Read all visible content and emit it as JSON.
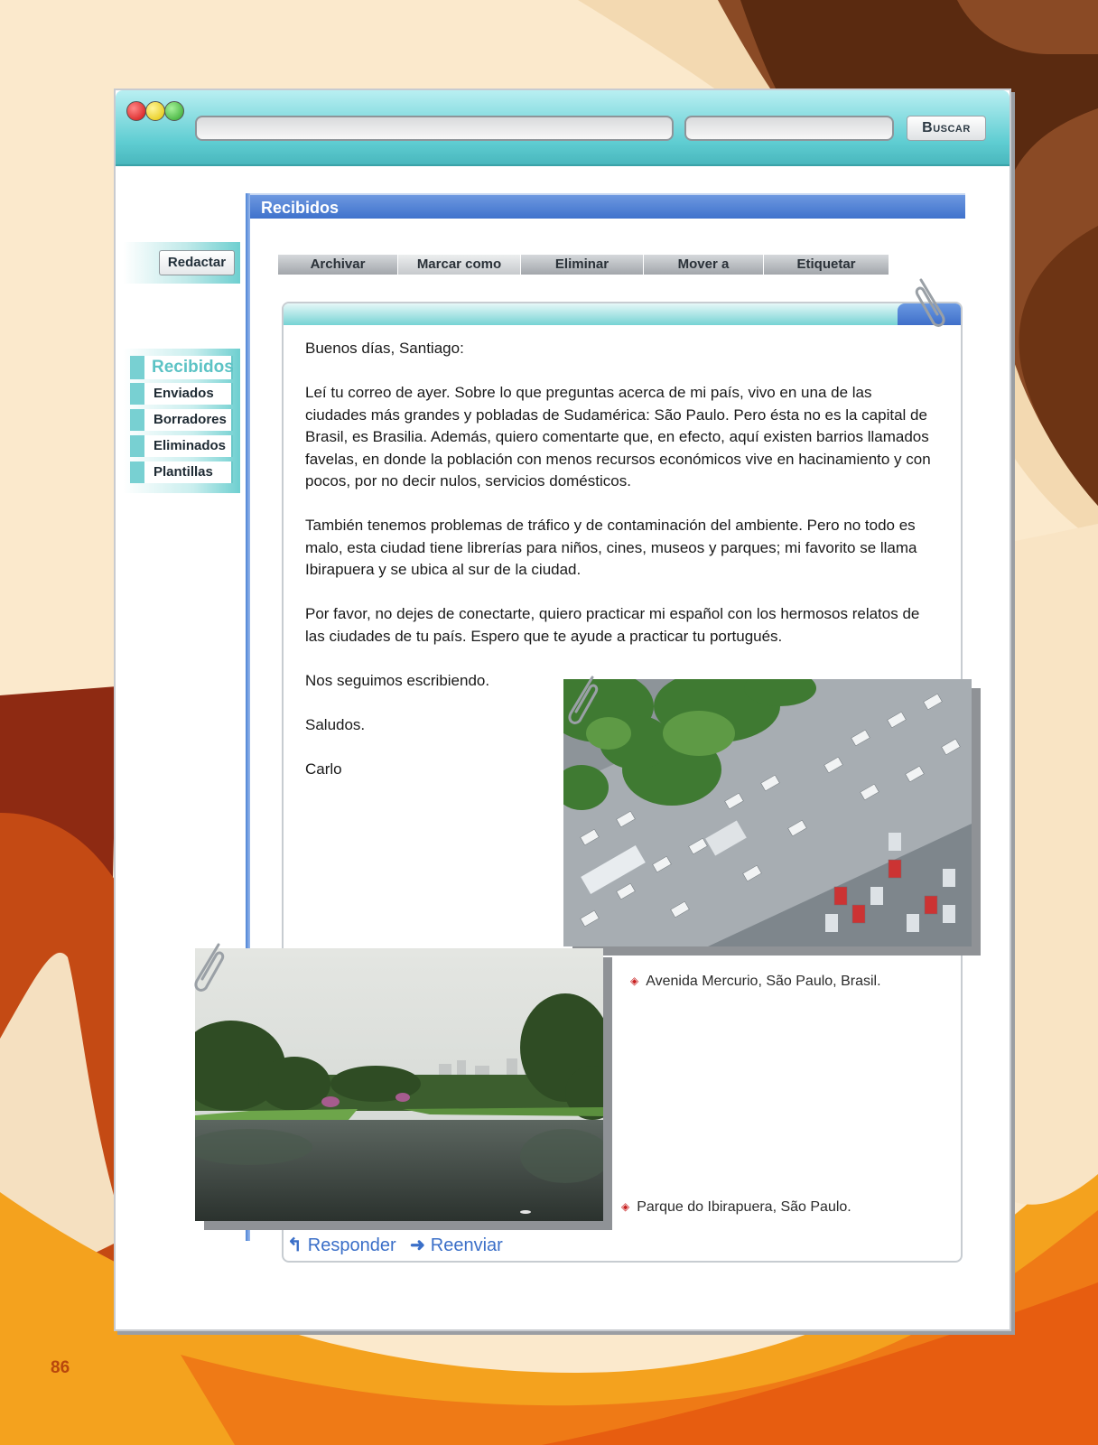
{
  "colors": {
    "titlebar": "#5fcdd2",
    "accent_blue": "#3f72cc",
    "link_blue": "#3b6fc8",
    "sidebar_teal": "#6ecfd0",
    "page_number": "#b8470d"
  },
  "browser": {
    "search_button": "Buscar",
    "traffic_lights": [
      "red",
      "yellow",
      "green"
    ]
  },
  "sidebar": {
    "compose": "Redactar",
    "folders": [
      {
        "label": "Recibidos",
        "active": true
      },
      {
        "label": "Enviados"
      },
      {
        "label": "Borradores"
      },
      {
        "label": "Eliminados"
      },
      {
        "label": "Plantillas"
      }
    ]
  },
  "inbox": {
    "title": "Recibidos"
  },
  "toolbar": {
    "buttons": [
      "Archivar",
      "Marcar como",
      "Eliminar",
      "Mover a",
      "Etiquetar"
    ]
  },
  "message": {
    "greeting": "Buenos días, Santiago:",
    "paragraph1": "Leí tu correo de ayer. Sobre lo que preguntas acerca de mi país, vivo en una de las ciudades más grandes y pobladas de Sudamérica: São Paulo. Pero ésta no es la capital de Brasil, es Brasilia. Además, quiero comentarte que, en efecto, aquí existen barrios llamados favelas, en donde la población con menos recursos económicos vive en hacinamiento y con pocos, por no decir nulos, servicios domésticos.",
    "paragraph2": "También tenemos problemas de tráfico y de contaminación del ambiente. Pero no todo es malo, esta ciudad tiene librerías para niños, cines, museos y parques; mi favorito se llama Ibirapuera y se ubica al sur de la ciudad.",
    "paragraph3": "Por favor, no dejes de conectarte, quiero practicar mi español con los hermosos relatos de las ciudades de tu país. Espero que te ayude a practicar tu portugués.",
    "closing1": "Nos seguimos escribiendo.",
    "closing2": "Saludos.",
    "signature": "Carlo"
  },
  "attachments": [
    {
      "caption": "Avenida Mercurio, São Paulo, Brasil."
    },
    {
      "caption": "Parque do Ibirapuera, São Paulo."
    }
  ],
  "actions": {
    "reply": "Responder",
    "forward": "Reenviar"
  },
  "page_number": "86"
}
